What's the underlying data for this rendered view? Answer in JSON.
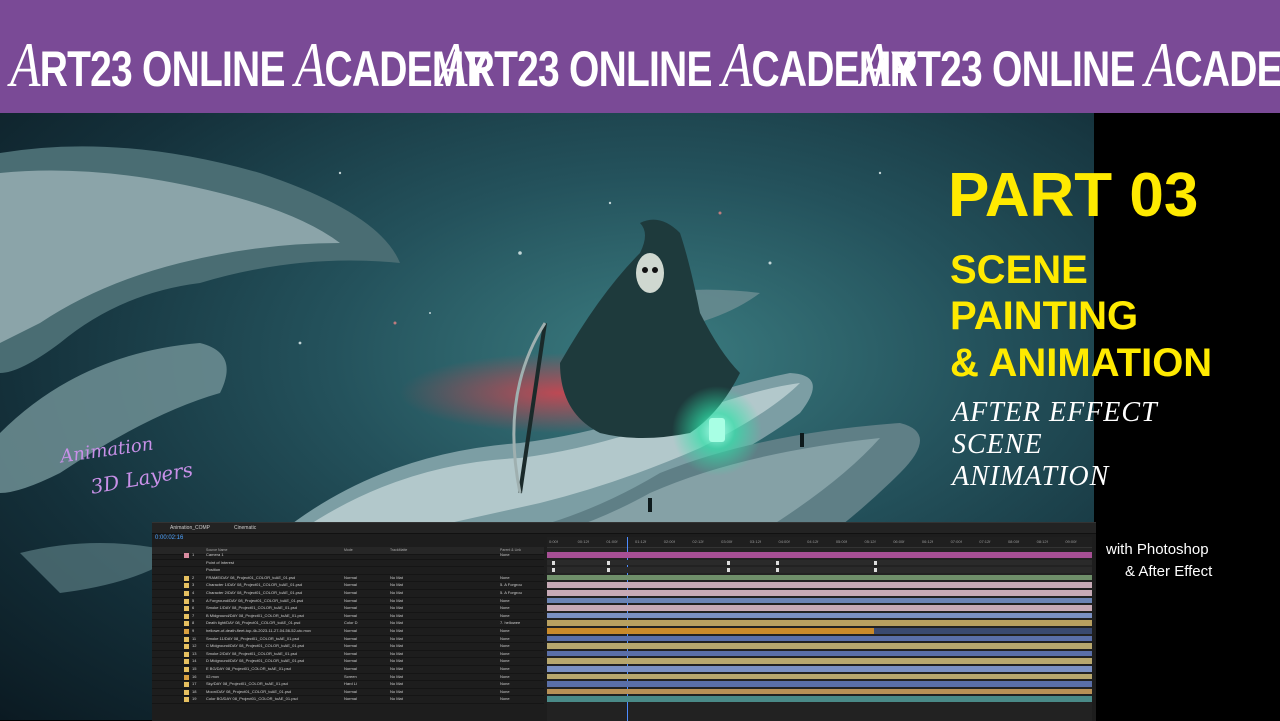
{
  "banner": {
    "repeats": [
      {
        "a": "A",
        "b": "RT23 ONLINE ",
        "c": "A",
        "d": "CADEMY"
      },
      {
        "a": "A",
        "b": "RT23 ONLINE ",
        "c": "A",
        "d": "CADEMY"
      },
      {
        "a": "A",
        "b": "RT23 ONLINE ",
        "c": "A",
        "d": "CADEMY"
      }
    ]
  },
  "title": {
    "part": "PART 03",
    "line1": "SCENE",
    "line2": "PAINTING",
    "line3": "& ANIMATION",
    "sub1": "AFTER EFFECT",
    "sub2": "SCENE",
    "sub3": "ANIMATION",
    "tools1": "with Photoshop",
    "tools2": "& After Effect"
  },
  "handwriting": {
    "line1": "Animation",
    "line2": "3D Layers"
  },
  "colors": {
    "banner": "#7a4a96",
    "accent": "#ffea00",
    "handwriting": "#c890e8",
    "timecode": "#4da3ff"
  },
  "ae": {
    "tabs": [
      "Animation_COMP",
      "Cinematic"
    ],
    "timecode": "0:00:02:16",
    "headers": {
      "name": "Source Name",
      "mode": "Mode",
      "trkmat": "TrackMatte",
      "parent": "Parent & Link"
    },
    "layers": [
      {
        "num": "1",
        "name": "Camera 1",
        "mode": "",
        "trk": "",
        "parent": "None",
        "color": "#d98ca0"
      },
      {
        "num": "",
        "name": "Point of Interest",
        "mode": "",
        "trk": "",
        "parent": "",
        "color": "#1d1d1d"
      },
      {
        "num": "",
        "name": "Position",
        "mode": "",
        "trk": "",
        "parent": "",
        "color": "#1d1d1d"
      },
      {
        "num": "2",
        "name": "FRAME/DAY 08_Project01_COLOR_toAE_01.psd",
        "mode": "Normal",
        "trk": "No Mat",
        "parent": "None",
        "color": "#e6c060"
      },
      {
        "num": "3",
        "name": "Character 1/DAY 08_Project01_COLOR_toAE_01.psd",
        "mode": "Normal",
        "trk": "No Mat",
        "parent": "5. A Forgrou",
        "color": "#e6c060"
      },
      {
        "num": "4",
        "name": "Character 2/DAY 08_Project01_COLOR_toAE_01.psd",
        "mode": "Normal",
        "trk": "No Mat",
        "parent": "5. A Forgrou",
        "color": "#e6c060"
      },
      {
        "num": "5",
        "name": "A Forground/DAY 08_Project01_COLOR_toAE_01.psd",
        "mode": "Normal",
        "trk": "No Mat",
        "parent": "None",
        "color": "#e6c060"
      },
      {
        "num": "6",
        "name": "Smoke 1/DAY 08_Project01_COLOR_toAE_01.psd",
        "mode": "Normal",
        "trk": "No Mat",
        "parent": "None",
        "color": "#e6c060"
      },
      {
        "num": "7",
        "name": "B Midground/DAY 08_Project01_COLOR_toAE_01.psd",
        "mode": "Normal",
        "trk": "No Mat",
        "parent": "None",
        "color": "#e6c060"
      },
      {
        "num": "8",
        "name": "Death light/DAY 08_Project01_COLOR_toAE_01.psd",
        "mode": "Color D",
        "trk": "No Mat",
        "parent": "7. hellowee",
        "color": "#e6c060"
      },
      {
        "num": "9",
        "name": "hellowe-of-death-fleet-top-4k-2023-11-27-04-56-52-utc.mov",
        "mode": "Normal",
        "trk": "No Mat",
        "parent": "None",
        "color": "#d9a040"
      },
      {
        "num": "11",
        "name": "Smoke 11/DAY 08_Project01_COLOR_toAE_01.psd",
        "mode": "Normal",
        "trk": "No Mat",
        "parent": "None",
        "color": "#e6c060"
      },
      {
        "num": "12",
        "name": "C Midground/DAY 08_Project01_COLOR_toAE_01.psd",
        "mode": "Normal",
        "trk": "No Mat",
        "parent": "None",
        "color": "#e6c060"
      },
      {
        "num": "13",
        "name": "Smoke 2/DAY 08_Project01_COLOR_toAE_01.psd",
        "mode": "Normal",
        "trk": "No Mat",
        "parent": "None",
        "color": "#e6c060"
      },
      {
        "num": "14",
        "name": "D Midground/DAY 08_Project01_COLOR_toAE_01.psd",
        "mode": "Normal",
        "trk": "No Mat",
        "parent": "None",
        "color": "#e6c060"
      },
      {
        "num": "15",
        "name": "E BG/DAY 08_Project01_COLOR_toAE_01.psd",
        "mode": "Normal",
        "trk": "No Mat",
        "parent": "None",
        "color": "#e6c060"
      },
      {
        "num": "16",
        "name": "02.mov",
        "mode": "Screen",
        "trk": "No Mat",
        "parent": "None",
        "color": "#d9a040"
      },
      {
        "num": "17",
        "name": "Sky/DAY 08_Project01_COLOR_toAE_01.psd",
        "mode": "Hard Li",
        "trk": "No Mat",
        "parent": "None",
        "color": "#e6c060"
      },
      {
        "num": "18",
        "name": "Moon/DAY 08_Project01_COLOR_toAE_01.psd",
        "mode": "Normal",
        "trk": "No Mat",
        "parent": "None",
        "color": "#e6c060"
      },
      {
        "num": "19",
        "name": "Color BG/DAY 08_Project01_COLOR_toAE_01.psd",
        "mode": "Normal",
        "trk": "No Mat",
        "parent": "None",
        "color": "#e6c060"
      }
    ],
    "bars": [
      {
        "color": "#a64f94",
        "w": 1.0
      },
      {
        "color": "#2a2a2a",
        "w": 1.0
      },
      {
        "color": "#2a2a2a",
        "w": 1.0
      },
      {
        "color": "#6f8f6a",
        "w": 1.0
      },
      {
        "color": "#c7aab6",
        "w": 1.0
      },
      {
        "color": "#c7aab6",
        "w": 1.0
      },
      {
        "color": "#6b84b4",
        "w": 1.0
      },
      {
        "color": "#c7aab6",
        "w": 1.0
      },
      {
        "color": "#7a90c2",
        "w": 1.0
      },
      {
        "color": "#b8a060",
        "w": 1.0
      },
      {
        "color": "#c98a2a",
        "w": 0.6
      },
      {
        "color": "#5a6fa8",
        "w": 1.0
      },
      {
        "color": "#b7a76e",
        "w": 1.0
      },
      {
        "color": "#5a6fa8",
        "w": 1.0
      },
      {
        "color": "#b7a76e",
        "w": 1.0
      },
      {
        "color": "#7a90c2",
        "w": 1.0
      },
      {
        "color": "#b7a76e",
        "w": 1.0
      },
      {
        "color": "#5a6fa8",
        "w": 1.0
      },
      {
        "color": "#b89056",
        "w": 1.0
      },
      {
        "color": "#4a8a88",
        "w": 1.0
      }
    ],
    "ruler": [
      "0:00f",
      "00:12f",
      "01:00f",
      "01:12f",
      "02:00f",
      "02:12f",
      "03:00f",
      "03:12f",
      "04:00f",
      "04:12f",
      "05:00f",
      "05:12f",
      "06:00f",
      "06:12f",
      "07:00f",
      "07:12f",
      "08:00f",
      "08:12f",
      "09:00f"
    ]
  }
}
